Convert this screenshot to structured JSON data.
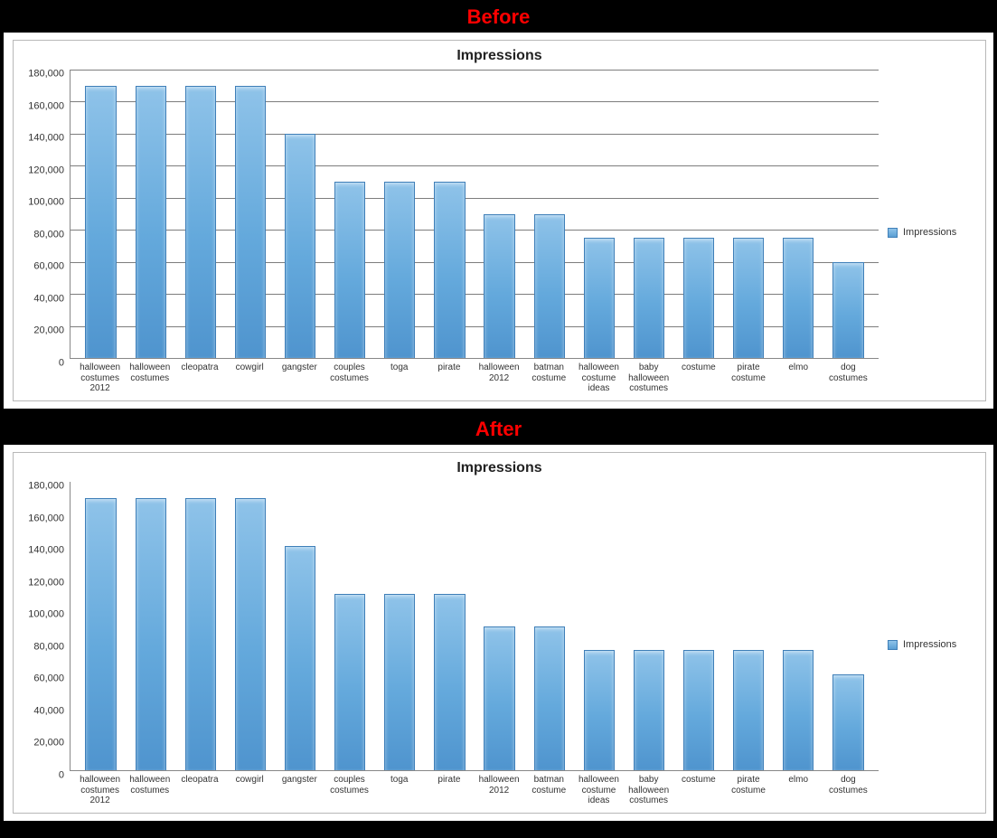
{
  "labels": {
    "before": "Before",
    "after": "After"
  },
  "chart_data": [
    {
      "type": "bar",
      "title": "Impressions",
      "legend": "Impressions",
      "xlabel": "",
      "ylabel": "",
      "ylim": [
        0,
        180000
      ],
      "y_ticks": [
        "180,000",
        "160,000",
        "140,000",
        "120,000",
        "100,000",
        "80,000",
        "60,000",
        "40,000",
        "20,000",
        "0"
      ],
      "gridlines": true,
      "categories": [
        "halloween costumes 2012",
        "halloween costumes",
        "cleopatra",
        "cowgirl",
        "gangster",
        "couples costumes",
        "toga",
        "pirate",
        "halloween 2012",
        "batman costume",
        "halloween costume ideas",
        "baby halloween costumes",
        "costume",
        "pirate costume",
        "elmo",
        "dog costumes"
      ],
      "values": [
        170000,
        170000,
        170000,
        170000,
        140000,
        110000,
        110000,
        110000,
        90000,
        90000,
        75000,
        75000,
        75000,
        75000,
        75000,
        60000
      ]
    },
    {
      "type": "bar",
      "title": "Impressions",
      "legend": "Impressions",
      "xlabel": "",
      "ylabel": "",
      "ylim": [
        0,
        180000
      ],
      "y_ticks": [
        "180,000",
        "160,000",
        "140,000",
        "120,000",
        "100,000",
        "80,000",
        "60,000",
        "40,000",
        "20,000",
        "0"
      ],
      "gridlines": false,
      "categories": [
        "halloween costumes 2012",
        "halloween costumes",
        "cleopatra",
        "cowgirl",
        "gangster",
        "couples costumes",
        "toga",
        "pirate",
        "halloween 2012",
        "batman costume",
        "halloween costume ideas",
        "baby halloween costumes",
        "costume",
        "pirate costume",
        "elmo",
        "dog costumes"
      ],
      "values": [
        170000,
        170000,
        170000,
        170000,
        140000,
        110000,
        110000,
        110000,
        90000,
        90000,
        75000,
        75000,
        75000,
        75000,
        75000,
        60000
      ]
    }
  ]
}
